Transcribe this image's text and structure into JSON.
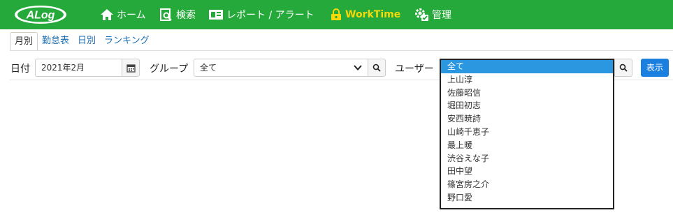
{
  "brand": {
    "logo_text": "ALog"
  },
  "nav": {
    "home": "ホーム",
    "search": "検索",
    "report": "レポート / アラート",
    "worktime": "WorkTime",
    "admin": "管理"
  },
  "colors": {
    "navbar": "#24a93a",
    "active_nav": "#f5d90a",
    "primary_button": "#1b7fe0",
    "selected_option": "#2a97e0"
  },
  "tabs": [
    "月別",
    "勤怠表",
    "日別",
    "ランキング"
  ],
  "filters": {
    "date_label": "日付",
    "date_value": "2021年2月",
    "group_label": "グループ",
    "group_value": "全て",
    "user_label": "ユーザー",
    "show_button": "表示"
  },
  "user_options": [
    "全て",
    "上山淳",
    "佐藤昭信",
    "堀田初志",
    "安西暁詩",
    "山崎千恵子",
    "最上暖",
    "渋谷えな子",
    "田中望",
    "篠宮房之介",
    "野口愛"
  ],
  "selected_user_index": 0
}
